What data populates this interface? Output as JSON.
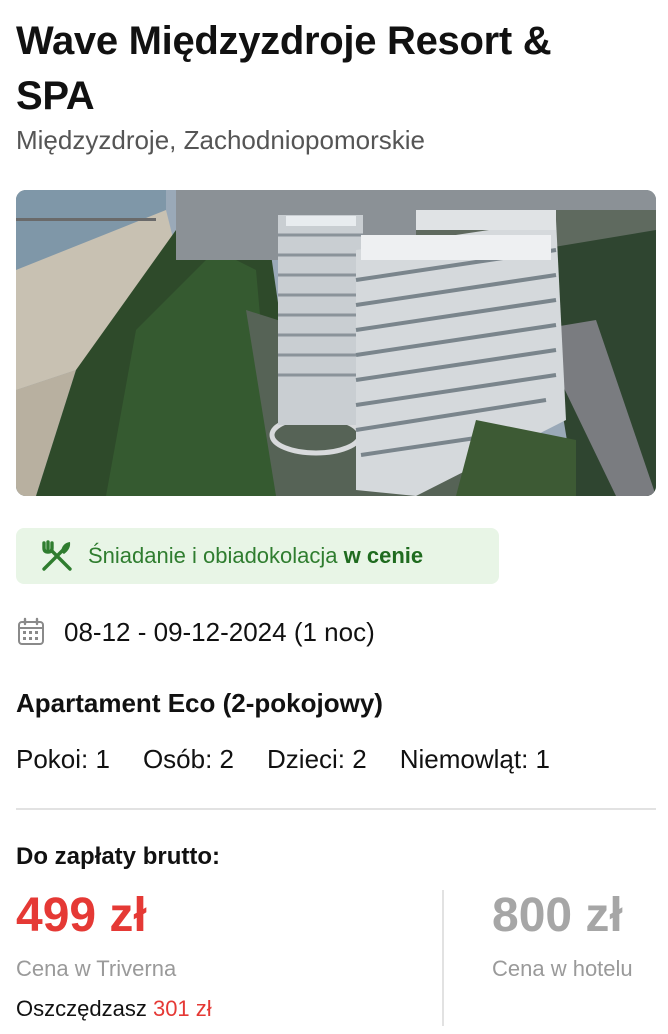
{
  "hotel": {
    "name": "Wave Międzyzdroje Resort & SPA",
    "location": "Międzyzdroje, Zachodniopomorskie"
  },
  "photo": {
    "icon": "hotel-photo"
  },
  "meal": {
    "icon": "fork-knife-icon",
    "text": "Śniadanie i obiadokolacja",
    "emphasis": "w cenie",
    "color": "#2f7d2f",
    "background": "#e8f5e6"
  },
  "stay": {
    "icon": "calendar-icon",
    "dates": "08-12 - 09-12-2024 (1 noc)"
  },
  "room": {
    "type": "Apartament Eco (2-pokojowy)",
    "occupancy": {
      "rooms": "Pokoi: 1",
      "adults": "Osób: 2",
      "children": "Dzieci: 2",
      "infants": "Niemowląt: 1"
    }
  },
  "payment": {
    "label": "Do zapłaty brutto:",
    "price": "499 zł",
    "price_caption": "Cena w Triverna",
    "savings_label": "Oszczędzasz",
    "savings_amount": "301 zł",
    "hotel_price": "800 zł",
    "hotel_price_caption": "Cena w hotelu",
    "accent_color": "#e53935"
  }
}
